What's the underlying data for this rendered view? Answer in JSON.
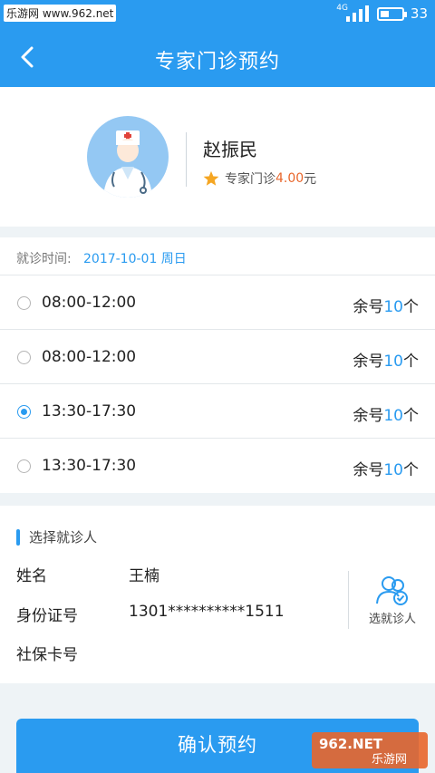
{
  "status_bar": {
    "watermark": "乐游网 www.962.net",
    "network": "4G",
    "battery": "33",
    "battery_level": 0.33
  },
  "header": {
    "title": "专家门诊预约",
    "back_icon": "chevron-left-icon"
  },
  "doctor": {
    "name": "赵振民",
    "clinic_type": "专家门诊",
    "fee": "4.00",
    "fee_unit": "元",
    "star_color": "#f5a623"
  },
  "visit": {
    "date_label": "就诊时间:",
    "date_value": "2017-10-01   周日"
  },
  "slots": [
    {
      "time": "08:00-12:00",
      "remain_prefix": "余号",
      "remain_count": "10",
      "remain_suffix": "个",
      "selected": false
    },
    {
      "time": "08:00-12:00",
      "remain_prefix": "余号",
      "remain_count": "10",
      "remain_suffix": "个",
      "selected": false
    },
    {
      "time": "13:30-17:30",
      "remain_prefix": "余号",
      "remain_count": "10",
      "remain_suffix": "个",
      "selected": true
    },
    {
      "time": "13:30-17:30",
      "remain_prefix": "余号",
      "remain_count": "10",
      "remain_suffix": "个",
      "selected": false
    }
  ],
  "patient": {
    "section_title": "选择就诊人",
    "name_label": "姓名",
    "name_value": "王楠",
    "id_label": "身份证号",
    "id_value": "1301**********1511",
    "insurance_label": "社保卡号",
    "insurance_value": "",
    "select_label": "选就诊人"
  },
  "confirm_button": "确认预约",
  "watermark_logo": "962.NET 乐游网",
  "colors": {
    "accent": "#2a9bf0",
    "price": "#e8662b"
  }
}
